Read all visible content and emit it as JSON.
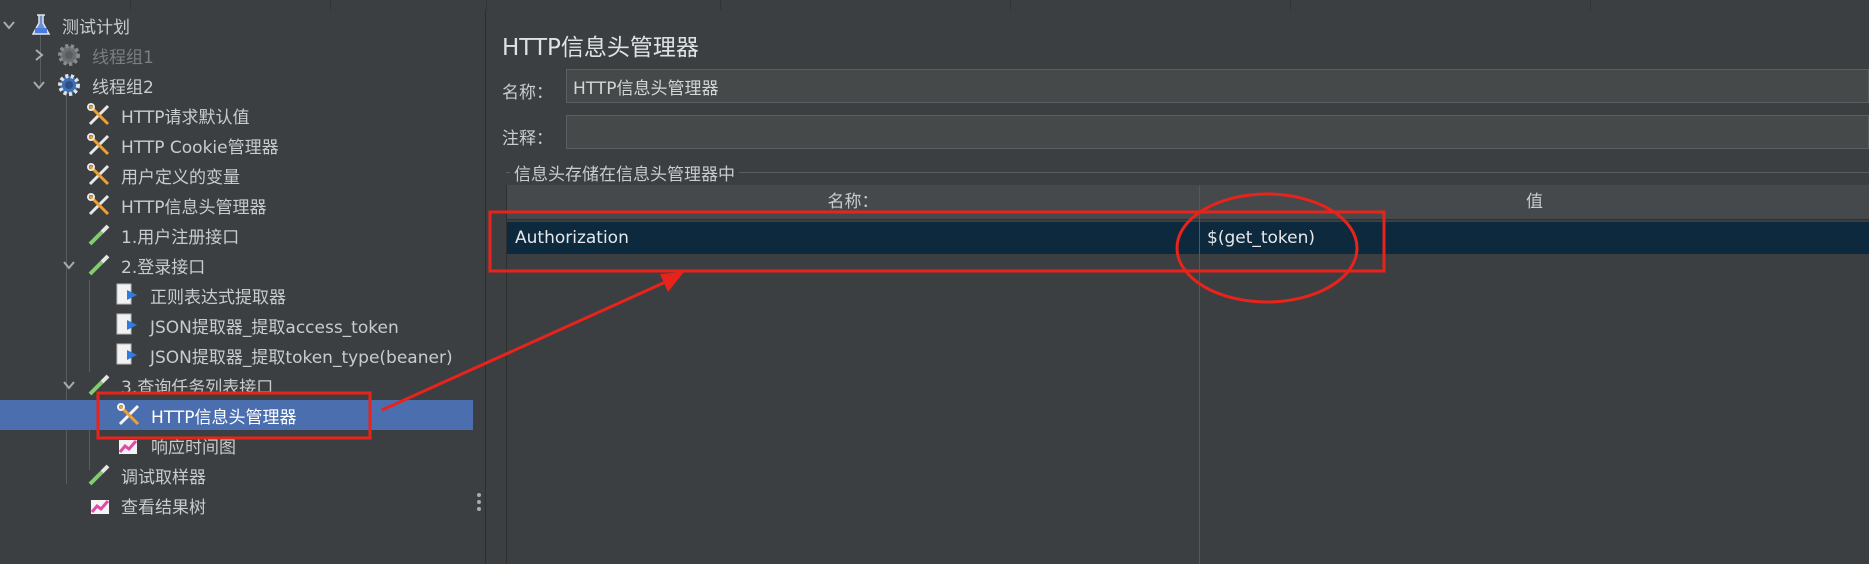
{
  "tree": {
    "items": [
      {
        "label": "测试计划",
        "icon": "flask-icon",
        "expanded": true
      },
      {
        "label": "线程组1",
        "icon": "gear-icon",
        "expanded": false,
        "disabled": true
      },
      {
        "label": "线程组2",
        "icon": "gear-icon",
        "expanded": true
      },
      {
        "label": "HTTP请求默认值",
        "icon": "wrench-screwdriver-icon"
      },
      {
        "label": "HTTP Cookie管理器",
        "icon": "wrench-screwdriver-icon"
      },
      {
        "label": "用户定义的变量",
        "icon": "wrench-screwdriver-icon"
      },
      {
        "label": "HTTP信息头管理器",
        "icon": "wrench-screwdriver-icon"
      },
      {
        "label": "1.用户注册接口",
        "icon": "pipette-icon"
      },
      {
        "label": "2.登录接口",
        "icon": "pipette-icon",
        "expanded": true
      },
      {
        "label": "正则表达式提取器",
        "icon": "extractor-icon"
      },
      {
        "label": "JSON提取器_提取access_token",
        "icon": "extractor-icon"
      },
      {
        "label": "JSON提取器_提取token_type(beaner)",
        "icon": "extractor-icon"
      },
      {
        "label": "3.查询任务列表接口",
        "icon": "pipette-icon",
        "expanded": true
      },
      {
        "label": "HTTP信息头管理器",
        "icon": "wrench-screwdriver-icon",
        "selected": true
      },
      {
        "label": "响应时间图",
        "icon": "graph-icon"
      },
      {
        "label": "调试取样器",
        "icon": "pipette-icon"
      },
      {
        "label": "查看结果树",
        "icon": "graph-icon"
      }
    ]
  },
  "panel": {
    "title": "HTTP信息头管理器",
    "name_label": "名称：",
    "name_value": "HTTP信息头管理器",
    "comment_label": "注释：",
    "comment_value": "",
    "group_title": "信息头存储在信息头管理器中",
    "table": {
      "columns": [
        "名称：",
        "值"
      ],
      "rows": [
        {
          "name": "Authorization",
          "value": "$(get_token)"
        }
      ]
    }
  },
  "colors": {
    "background": "#3c3f41",
    "selection": "#4b6eaf",
    "row_selection": "#0d293e",
    "annotation": "#e8231b"
  }
}
